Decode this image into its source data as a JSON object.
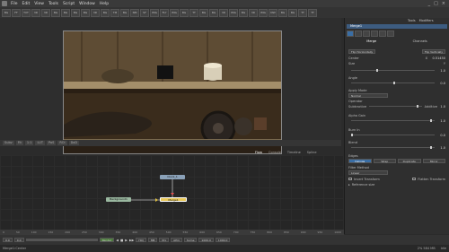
{
  "app": {
    "menu": [
      "File",
      "Edit",
      "View",
      "Tools",
      "Script",
      "Window",
      "Help"
    ],
    "window_buttons": [
      "_",
      "□",
      "×"
    ]
  },
  "toolbar": {
    "buttons": [
      "BG",
      "FF",
      "TXT",
      "3D",
      "3D",
      "BG",
      "BG",
      "BG",
      "BG",
      "3D",
      "BG",
      "TM",
      "BG",
      "NM",
      "SF",
      "IMG",
      "FLY",
      "IMG",
      "BG",
      "TT",
      "BG",
      "BG",
      "3D",
      "IMG",
      "BG",
      "3D",
      "IMG",
      "MW",
      "BG",
      "BG",
      "TT",
      "TT"
    ]
  },
  "viewer": {
    "label": "Merge1",
    "bar": [
      "Subv",
      "Fit",
      "1:1",
      "LUT",
      "PoS",
      "ROI",
      "DoD"
    ]
  },
  "flow": {
    "tabs": [
      "Flow",
      "Console",
      "Timeline",
      "Spline"
    ],
    "nodes": {
      "top": "Clock_1",
      "left": "Background1",
      "merge": "Merge1"
    }
  },
  "rightpanel": {
    "tabs": [
      "Tools",
      "Modifiers"
    ],
    "tool_title": "Merge1",
    "sub_tabs": [
      "Merge",
      "Channels"
    ],
    "flip_h": "Flip Horizontally",
    "flip_v": "Flip Vertically",
    "center_label": "Center",
    "center_x_label": "X",
    "center_x": "0.5",
    "center_y_label": "Y",
    "center_y": "0.5",
    "size_label": "Size",
    "size_value": "1.0",
    "angle_label": "Angle",
    "angle_value": "0.0",
    "apply_mode_label": "Apply Mode",
    "apply_mode_value": "Normal",
    "operator_label": "Operator",
    "operator_value": "Over",
    "subtractive_label": "Subtractive",
    "additive_label": "Additive",
    "add_value": "1.0",
    "alpha_gain_label": "Alpha Gain",
    "alpha_gain_value": "1.0",
    "burn_in_label": "Burn In",
    "burn_in_value": "0.0",
    "blend_label": "Blend",
    "blend_value": "1.0",
    "edges_label": "Edges",
    "edge_buttons": [
      "Canvas",
      "Wrap",
      "Duplicate",
      "Mirror"
    ],
    "filter_label": "Filter Method",
    "filter_value": "Linear",
    "invert_label": "Invert Transform",
    "flatten_label": "Flatten Transform",
    "ref_size_label": "Reference size",
    "edit_values": [
      "0.51450",
      "1.0",
      "1.0"
    ]
  },
  "timeline": {
    "ticks": [
      "0",
      "50",
      "100",
      "150",
      "200",
      "250",
      "300",
      "350",
      "400",
      "450",
      "500",
      "550",
      "600",
      "650",
      "700",
      "750",
      "800",
      "850",
      "900",
      "950",
      "1000"
    ]
  },
  "transport": {
    "start": "0.0",
    "current": "0.0",
    "render_label": "Render",
    "hiq": "HiQ",
    "mb": "MB",
    "prx": "Prx",
    "aprx": "APrx",
    "some": "Some",
    "end_a": "1000.0",
    "end_b": "1000.0"
  },
  "status": {
    "left": "Merge1:Center",
    "memory": "2% 584 MB",
    "state": "Idle"
  }
}
